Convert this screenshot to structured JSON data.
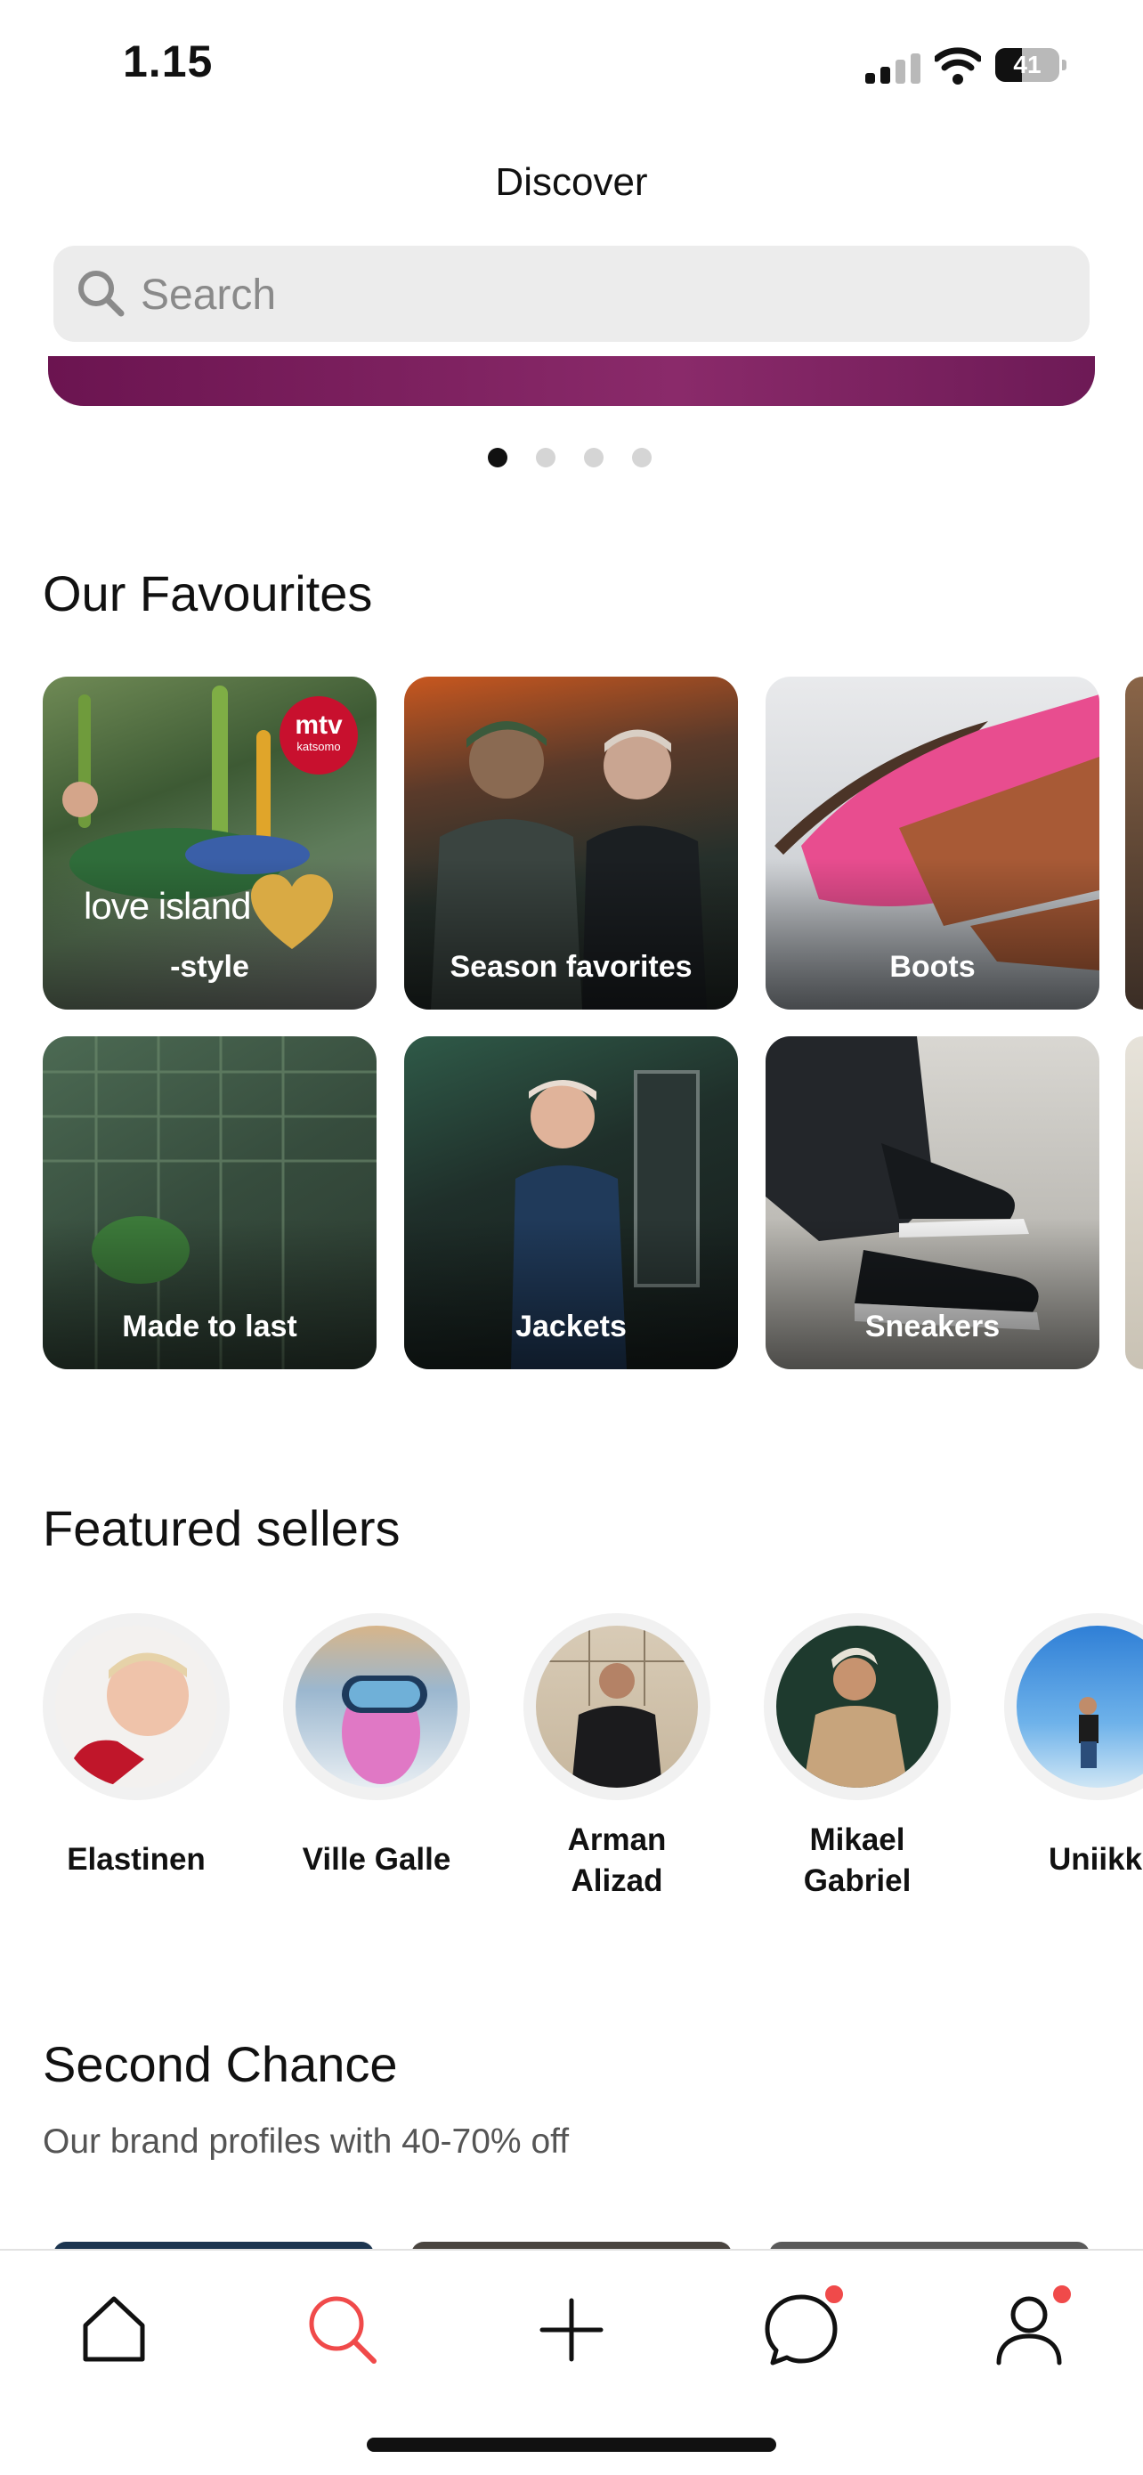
{
  "status": {
    "time": "1.15",
    "battery": "41",
    "battery_level": 0.41
  },
  "header": {
    "title": "Discover"
  },
  "search": {
    "placeholder": "Search",
    "icon": "search-icon"
  },
  "carousel": {
    "pages": 4,
    "active_index": 0
  },
  "favourites": {
    "title": "Our Favourites",
    "tiles": [
      {
        "label": "-style",
        "brand_text": "love island",
        "badge": {
          "line1": "mtv",
          "line2": "katsomo"
        }
      },
      {
        "label": "Season favorites"
      },
      {
        "label": "Boots"
      },
      {
        "label": "Made to last"
      },
      {
        "label": "Jackets"
      },
      {
        "label": "Sneakers"
      }
    ]
  },
  "sellers": {
    "title": "Featured sellers",
    "items": [
      {
        "name": "Elastinen"
      },
      {
        "name": "Ville Galle"
      },
      {
        "name": "Arman\nAlizad"
      },
      {
        "name": "Mikael\nGabriel"
      },
      {
        "name": "Uniikki"
      }
    ]
  },
  "second_chance": {
    "title": "Second Chance",
    "subtitle": "Our brand profiles with 40-70% off"
  },
  "nav": {
    "items": [
      {
        "icon": "home-icon"
      },
      {
        "icon": "search-icon",
        "active": true,
        "color": "#f04a4a"
      },
      {
        "icon": "plus-icon"
      },
      {
        "icon": "chat-icon",
        "badge": true
      },
      {
        "icon": "profile-icon",
        "badge": true
      }
    ]
  },
  "colors": {
    "accent": "#f04a4a",
    "text": "#111111",
    "muted": "#555555",
    "search_bg": "#ececec"
  }
}
